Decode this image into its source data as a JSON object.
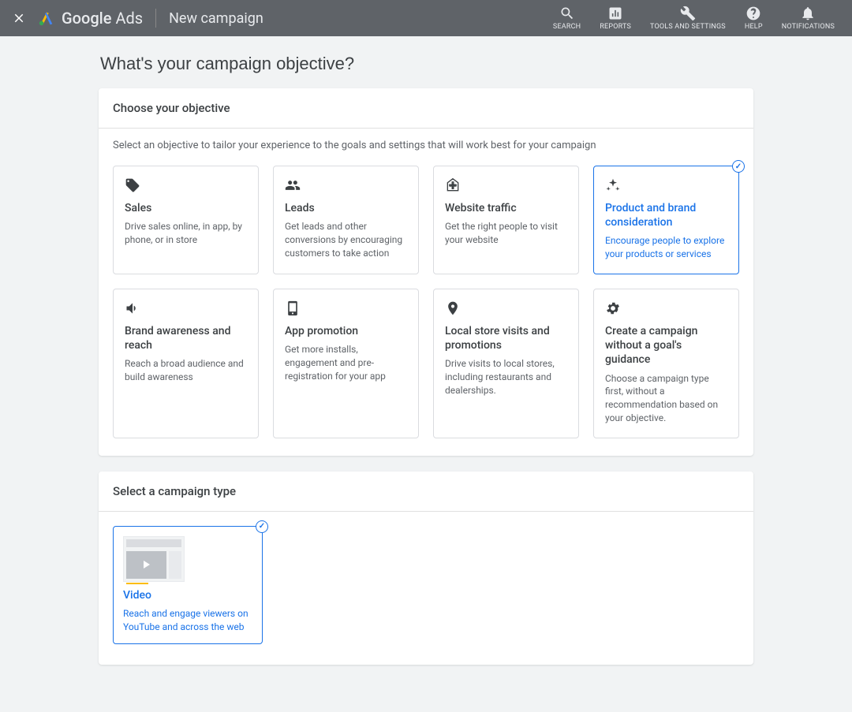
{
  "brand": {
    "name": "Google",
    "product": "Ads"
  },
  "header": {
    "title": "New campaign"
  },
  "toolbar": {
    "search": "SEARCH",
    "reports": "REPORTS",
    "tools": "TOOLS AND SETTINGS",
    "help": "HELP",
    "notifications": "NOTIFICATIONS"
  },
  "heading": "What's your campaign objective?",
  "objective_panel": {
    "title": "Choose your objective",
    "subtitle": "Select an objective to tailor your experience to the goals and settings that will work best for your campaign"
  },
  "objectives": [
    {
      "title": "Sales",
      "desc": "Drive sales online, in app, by phone, or in store"
    },
    {
      "title": "Leads",
      "desc": "Get leads and other conversions by encouraging customers to take action"
    },
    {
      "title": "Website traffic",
      "desc": "Get the right people to visit your website"
    },
    {
      "title": "Product and brand consideration",
      "desc": "Encourage people to explore your products or services"
    },
    {
      "title": "Brand awareness and reach",
      "desc": "Reach a broad audience and build awareness"
    },
    {
      "title": "App promotion",
      "desc": "Get more installs, engagement and pre-registration for your app"
    },
    {
      "title": "Local store visits and promotions",
      "desc": "Drive visits to local stores, including restaurants and dealerships."
    },
    {
      "title": "Create a campaign without a goal's guidance",
      "desc": "Choose a campaign type first, without a recommendation based on your objective."
    }
  ],
  "selected_objective_index": 3,
  "type_panel": {
    "title": "Select a campaign type"
  },
  "campaign_types": [
    {
      "title": "Video",
      "desc": "Reach and engage viewers on YouTube and across the web"
    }
  ],
  "selected_type_index": 0
}
